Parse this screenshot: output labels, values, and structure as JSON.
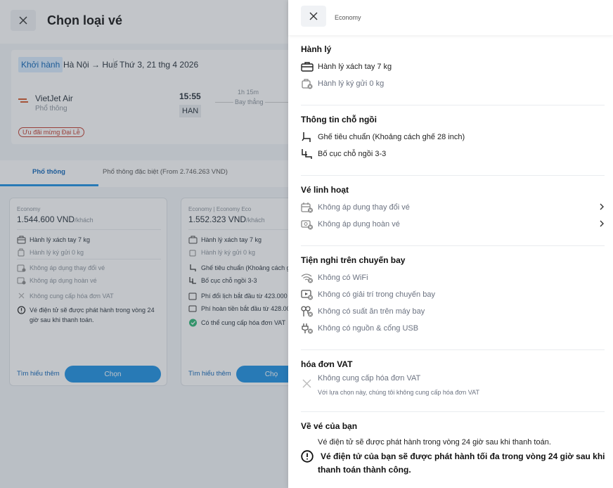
{
  "background": {
    "title": "Chọn loại vé",
    "flight": {
      "chip": "Khởi hành",
      "route": "Hà Nội → Huế",
      "date": "Thứ 3, 21 thg 4 2026",
      "airline": "VietJet Air",
      "cabin": "Phổ thông",
      "depart_time": "15:55",
      "duration": "1h 15m",
      "stops": "Bay thẳng",
      "depart_airport": "HAN",
      "promo": "Ưu đãi mừng Đại Lễ"
    },
    "tabs": [
      "Phổ thông",
      "Phổ thông đặc biệt (From 2.746.263 VND)"
    ],
    "cards": [
      {
        "class": "Economy",
        "price": "1.544.600 VND",
        "per": "/khách",
        "rows": [
          "Hành lý xách tay 7 kg",
          "Hành lý ký gửi 0 kg",
          "Không áp dụng thay đổi vé",
          "Không áp dụng hoàn vé",
          "Không cung cấp hóa đơn VAT",
          "Vé điện tử sẽ được phát hành trong vòng 24 giờ sau khi thanh toán."
        ],
        "learn": "Tìm hiểu thêm",
        "choose": "Chọn"
      },
      {
        "class": "Economy | Economy Eco",
        "price": "1.552.323 VND",
        "per": "/khách",
        "rows": [
          "Hành lý xách tay 7 kg",
          "Hành lý ký gửi 0 kg",
          "Ghế tiêu chuẩn (Khoảng cách gh",
          "Bố cục chỗ ngồi 3-3",
          "Phí đổi lịch bắt đầu từ 423.000 V",
          "Phí hoàn tiền bắt đầu từ 428.00",
          "Có thể cung cấp hóa đơn VAT"
        ],
        "learn": "Tìm hiểu thêm",
        "choose": "Chọ"
      }
    ]
  },
  "drawer": {
    "header": "Economy",
    "sections": {
      "baggage": {
        "title": "Hành lý",
        "items": [
          "Hành lý xách tay 7 kg",
          "Hành lý ký gửi 0 kg"
        ]
      },
      "seat": {
        "title": "Thông tin chỗ ngồi",
        "items": [
          "Ghế tiêu chuẩn (Khoảng cách ghế 28 inch)",
          "Bố cục chỗ ngồi 3-3"
        ]
      },
      "flex": {
        "title": "Vé linh hoạt",
        "items": [
          "Không áp dụng thay đổi vé",
          "Không áp dụng hoàn vé"
        ]
      },
      "amenities": {
        "title": "Tiện nghi trên chuyến bay",
        "items": [
          "Không có WiFi",
          "Không có giải trí trong chuyến bay",
          "Không có suất ăn trên máy bay",
          "Không có nguồn & cổng USB"
        ]
      },
      "vat": {
        "title": "hóa đơn VAT",
        "item": "Không cung cấp hóa đơn VAT",
        "sub": "Với lựa chọn này, chúng tôi không cung cấp hóa đơn VAT"
      },
      "ticket": {
        "title": "Về vé của bạn",
        "line1": "Vé điện tử sẽ được phát hành trong vòng 24 giờ sau khi thanh toán.",
        "line2a": "Vé điện tử của bạn sẽ được phát hành tối đa trong vòng 24 giờ sau khi",
        "line2b": "thanh toán thành công."
      }
    }
  },
  "colors": {
    "accent": "#1a8fe3",
    "promo": "#c0392b",
    "success": "#2bb673"
  }
}
